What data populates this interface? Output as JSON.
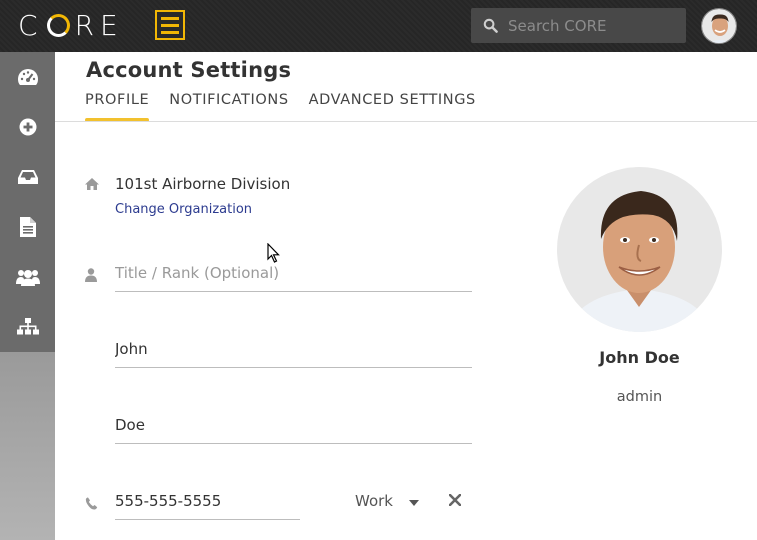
{
  "app": {
    "logo_text_1": "C",
    "logo_text_2": "RE",
    "logo_full": "CORE",
    "accent_color": "#f2b705"
  },
  "search": {
    "placeholder": "Search CORE",
    "icon": "search-icon"
  },
  "sidebar": {
    "items": [
      {
        "icon": "dashboard-gauge-icon"
      },
      {
        "icon": "plus-circle-icon"
      },
      {
        "icon": "inbox-tray-icon"
      },
      {
        "icon": "document-icon"
      },
      {
        "icon": "users-group-icon"
      },
      {
        "icon": "org-chart-icon"
      }
    ]
  },
  "page": {
    "title": "Account Settings",
    "tabs": [
      {
        "label": "PROFILE",
        "active": true
      },
      {
        "label": "NOTIFICATIONS",
        "active": false
      },
      {
        "label": "ADVANCED SETTINGS",
        "active": false
      }
    ]
  },
  "form": {
    "organization": "101st Airborne Division",
    "change_org_link": "Change Organization",
    "title_rank": {
      "value": "",
      "placeholder": "Title / Rank (Optional)"
    },
    "first_name": {
      "value": "John",
      "placeholder": ""
    },
    "last_name": {
      "value": "Doe",
      "placeholder": ""
    },
    "phone": {
      "value": "555-555-5555",
      "placeholder": ""
    },
    "phone_type": "Work"
  },
  "profile": {
    "name": "John Doe",
    "role": "admin"
  }
}
